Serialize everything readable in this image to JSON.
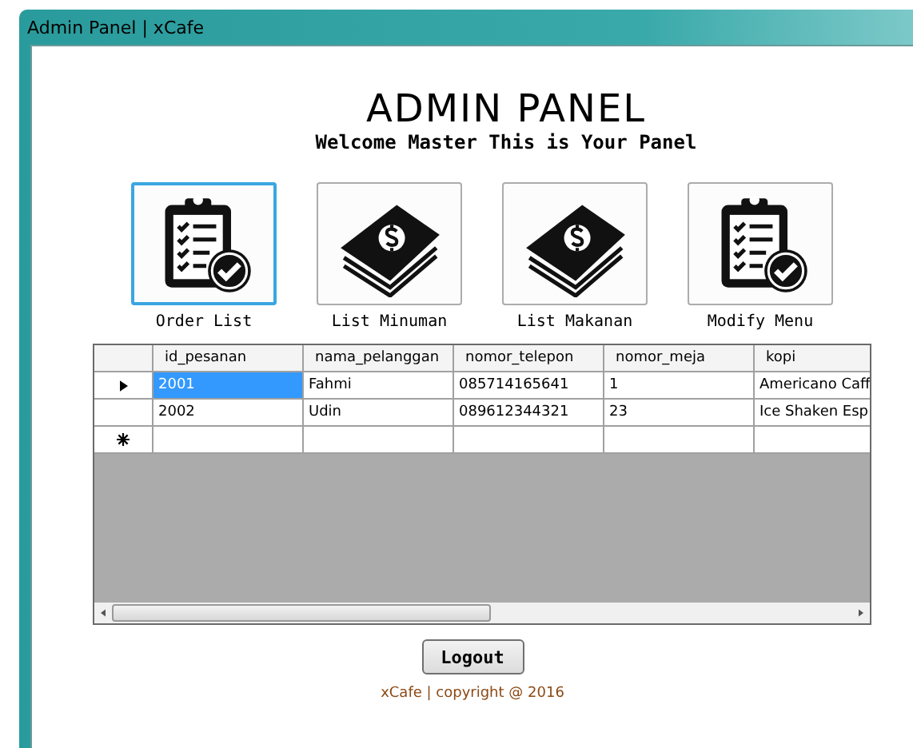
{
  "window": {
    "title": "Admin Panel | xCafe"
  },
  "header": {
    "title": "ADMIN PANEL",
    "subtitle": "Welcome Master This is Your Panel"
  },
  "menu": [
    {
      "label": "Order List",
      "kind": "clipboard",
      "selected": true
    },
    {
      "label": "List Minuman",
      "kind": "money",
      "selected": false
    },
    {
      "label": "List Makanan",
      "kind": "money",
      "selected": false
    },
    {
      "label": "Modify Menu",
      "kind": "clipboard",
      "selected": false
    }
  ],
  "table": {
    "columns": [
      "id_pesanan",
      "nama_pelanggan",
      "nomor_telepon",
      "nomor_meja",
      "kopi"
    ],
    "rows": [
      {
        "current": true,
        "cells": [
          "2001",
          "Fahmi",
          "085714165641",
          "1",
          "Americano Caff"
        ]
      },
      {
        "current": false,
        "cells": [
          "2002",
          "Udin",
          "089612344321",
          "23",
          "Ice Shaken Esp"
        ]
      }
    ]
  },
  "logout_button": "Logout",
  "footer": "xCafe | copyright @ 2016"
}
